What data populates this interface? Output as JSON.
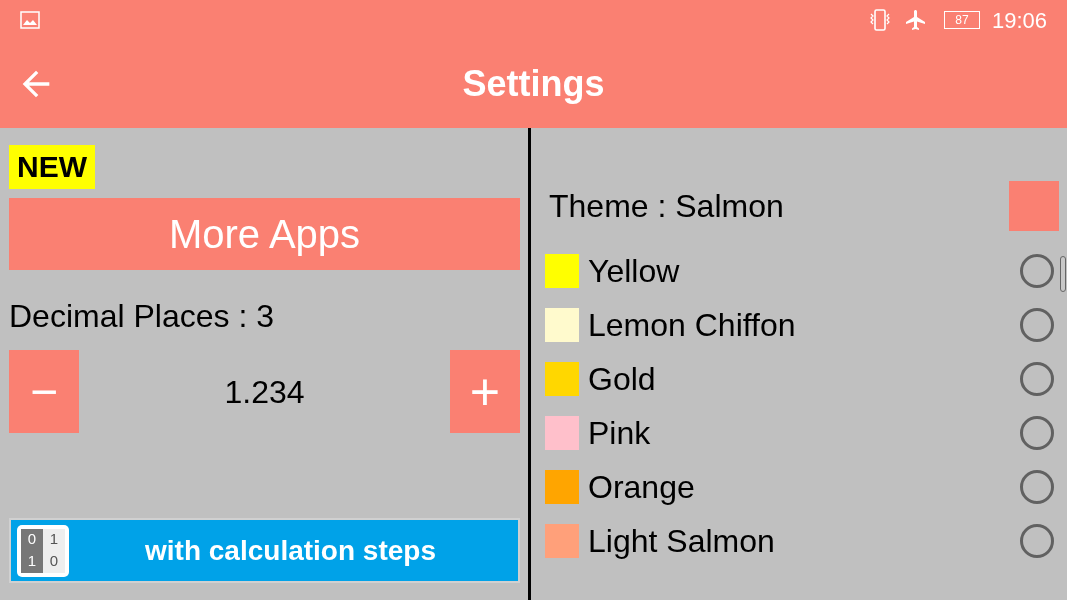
{
  "status_bar": {
    "time": "19:06",
    "battery": "87"
  },
  "header": {
    "title": "Settings"
  },
  "left": {
    "badge": "NEW",
    "more_apps": "More Apps",
    "decimal_label": "Decimal Places : 3",
    "minus": "−",
    "plus": "+",
    "preview": "1.234",
    "banner": {
      "text": "with calculation steps",
      "digits": [
        "0",
        "1",
        "1",
        "0"
      ]
    }
  },
  "theme": {
    "label": "Theme : Salmon",
    "color": "#fa8072"
  },
  "colors": [
    {
      "name": "Yellow",
      "color": "#ffff00",
      "selected": false
    },
    {
      "name": "Lemon Chiffon",
      "color": "#fffacd",
      "selected": false
    },
    {
      "name": "Gold",
      "color": "#ffd700",
      "selected": false
    },
    {
      "name": "Pink",
      "color": "#ffc0cb",
      "selected": false
    },
    {
      "name": "Orange",
      "color": "#ffa500",
      "selected": false
    },
    {
      "name": "Light Salmon",
      "color": "#ffa07a",
      "selected": false
    }
  ]
}
